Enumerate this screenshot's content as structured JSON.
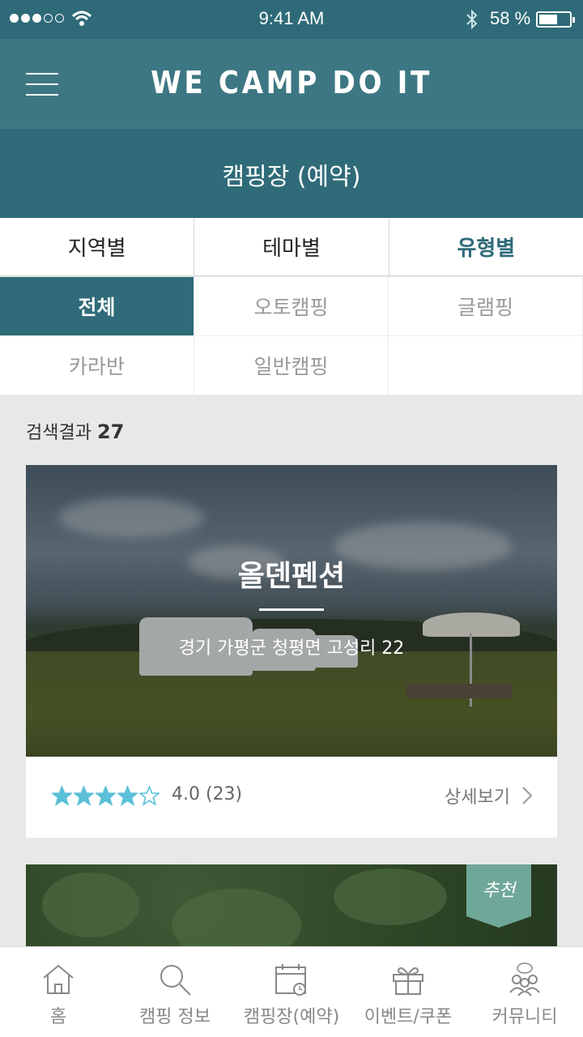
{
  "status_bar": {
    "time": "9:41 AM",
    "battery": "58 %",
    "battery_level": 0.58
  },
  "header": {
    "title": "WE CAMP DO IT"
  },
  "page": {
    "title": "캠핑장 (예약)"
  },
  "category_tabs": [
    {
      "label": "지역별",
      "active": false
    },
    {
      "label": "테마별",
      "active": false
    },
    {
      "label": "유형별",
      "active": true
    }
  ],
  "type_filters": [
    {
      "label": "전체",
      "active": true
    },
    {
      "label": "오토캠핑",
      "active": false
    },
    {
      "label": "글램핑",
      "active": false
    },
    {
      "label": "카라반",
      "active": false
    },
    {
      "label": "일반캠핑",
      "active": false
    }
  ],
  "results": {
    "label": "검색결과",
    "count": "27"
  },
  "cards": [
    {
      "name": "올덴펜션",
      "address": "경기 가평군 청평면 고성리 22",
      "rating": 4.0,
      "rating_text": "4.0 (23)",
      "detail_label": "상세보기"
    },
    {
      "badge": "추천"
    }
  ],
  "colors": {
    "primary": "#2f6b78",
    "header": "#3d7783",
    "star": "#5bc0d8",
    "badge": "#6fa798"
  },
  "bottom_nav": [
    {
      "label": "홈",
      "icon": "home-icon"
    },
    {
      "label": "캠핑 정보",
      "icon": "search-icon"
    },
    {
      "label": "캠핑장(예약)",
      "icon": "calendar-icon"
    },
    {
      "label": "이벤트/쿠폰",
      "icon": "gift-icon"
    },
    {
      "label": "커뮤니티",
      "icon": "community-icon"
    }
  ]
}
